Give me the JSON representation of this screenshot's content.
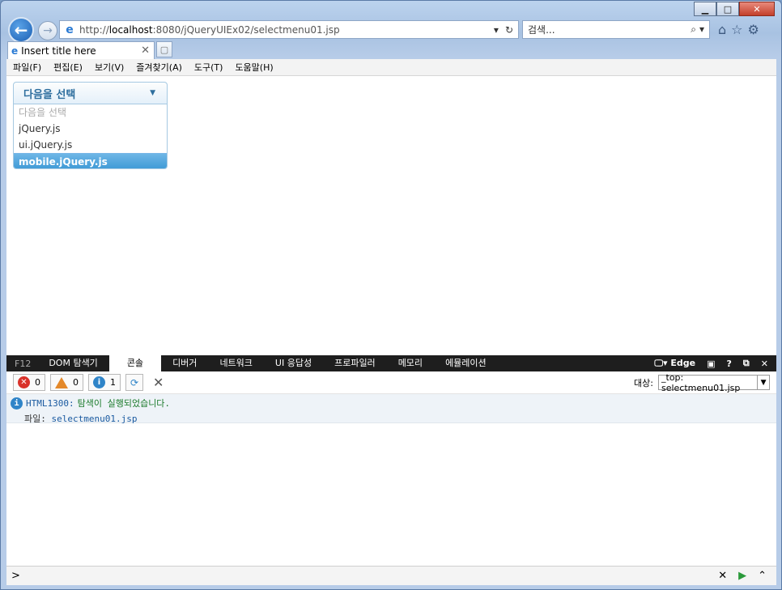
{
  "browser": {
    "address_prefix": "http://",
    "address_host": "localhost",
    "address_rest": ":8080/jQueryUIEx02/selectmenu01.jsp",
    "search_placeholder": "검색...",
    "tab_title": "Insert title here"
  },
  "menubar": [
    "파일(F)",
    "편집(E)",
    "보기(V)",
    "즐겨찾기(A)",
    "도구(T)",
    "도움말(H)"
  ],
  "selectmenu": {
    "button_label": "다음을 선택",
    "options": [
      "다음을 선택",
      "jQuery.js",
      "ui.jQuery.js",
      "mobile.jQuery.js"
    ],
    "active_index": 3
  },
  "devtools": {
    "f12_label": "F12",
    "tabs": [
      "DOM 탐색기",
      "콘솔",
      "디버거",
      "네트워크",
      "UI 응답성",
      "프로파일러",
      "메모리",
      "에뮬레이션"
    ],
    "selected_tab": "콘솔",
    "mode_label": "Edge",
    "counts": {
      "errors": "0",
      "warnings": "0",
      "info": "1"
    },
    "target_label": "대상:",
    "target_value": "_top: selectmenu01.jsp",
    "message": {
      "code": "HTML1300:",
      "text": "탐색이 실행되었습니다.",
      "file_label": "파일:",
      "file_name": "selectmenu01.jsp"
    },
    "prompt": ">"
  }
}
